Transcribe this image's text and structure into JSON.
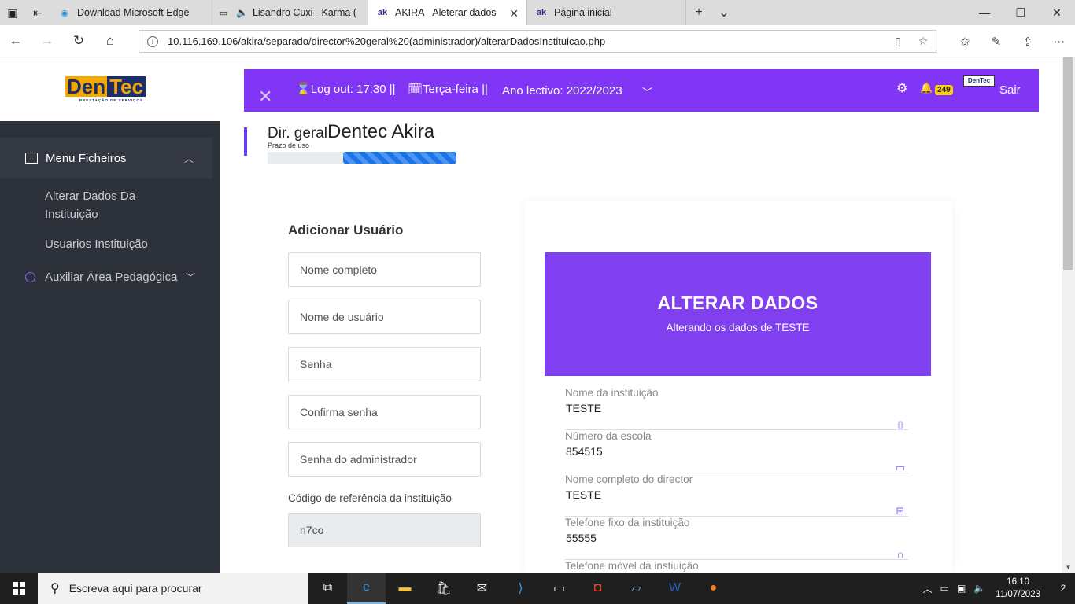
{
  "browser": {
    "tabs": [
      {
        "label": "Download Microsoft Edge",
        "icon": "edge-icon"
      },
      {
        "label": "Lisandro Cuxi - Karma (",
        "icon": "page-icon"
      },
      {
        "label": "AKIRA - Aleterar dados",
        "icon": "ak-icon",
        "fav": "ak"
      },
      {
        "label": "Página inicial",
        "icon": "ak-icon",
        "fav": "ak"
      }
    ],
    "url": "10.116.169.106/akira/separado/director%20geral%20(administrador)/alterarDadosInstituicao.php"
  },
  "sidebar": {
    "logo_den": "Den",
    "logo_tec": "Tec",
    "logo_sub": "PRESTAÇÃO DE SERVIÇOS",
    "menu_label": "Menu Ficheiros",
    "items": [
      "Alterar Dados Da Instituição",
      "Usuarios Instituição"
    ],
    "menu2_label": "Auxiliar Àrea Pedagógica"
  },
  "topbar": {
    "logout": "Log out: 17:30 ||",
    "day": "Terça-feira ||",
    "year": "Ano lectivo: 2022/2023",
    "badge": "249",
    "sair": "Sair",
    "accent": "#8135f5"
  },
  "header": {
    "role": "Dir. geral",
    "name": "Dentec Akira",
    "prazo": "Prazo de uso",
    "progress_fill_fraction": 0.6
  },
  "form": {
    "title": "Adicionar Usuário",
    "placeholders": [
      "Nome completo",
      "Nome de usuário",
      "Senha",
      "Confirma senha",
      "Senha do administrador"
    ],
    "code_label": "Código de referência da instituição",
    "code_value": "n7co"
  },
  "card": {
    "title": "ALTERAR DADOS",
    "subtitle": "Alterando os dados de TESTE",
    "rows": [
      {
        "label": "Nome da instituição",
        "value": "TESTE",
        "icon": "book-icon"
      },
      {
        "label": "Número da escola",
        "value": "854515",
        "icon": "card-icon"
      },
      {
        "label": "Nome completo do director",
        "value": "TESTE",
        "icon": "briefcase-icon"
      },
      {
        "label": "Telefone fixo da instituição",
        "value": "55555",
        "icon": "headset-icon"
      },
      {
        "label": "Telefone móvel da instiuição",
        "value": "",
        "icon": ""
      }
    ]
  },
  "taskbar": {
    "search": "Escreva aqui para procurar",
    "time": "16:10",
    "date": "11/07/2023",
    "notifications": "2"
  }
}
